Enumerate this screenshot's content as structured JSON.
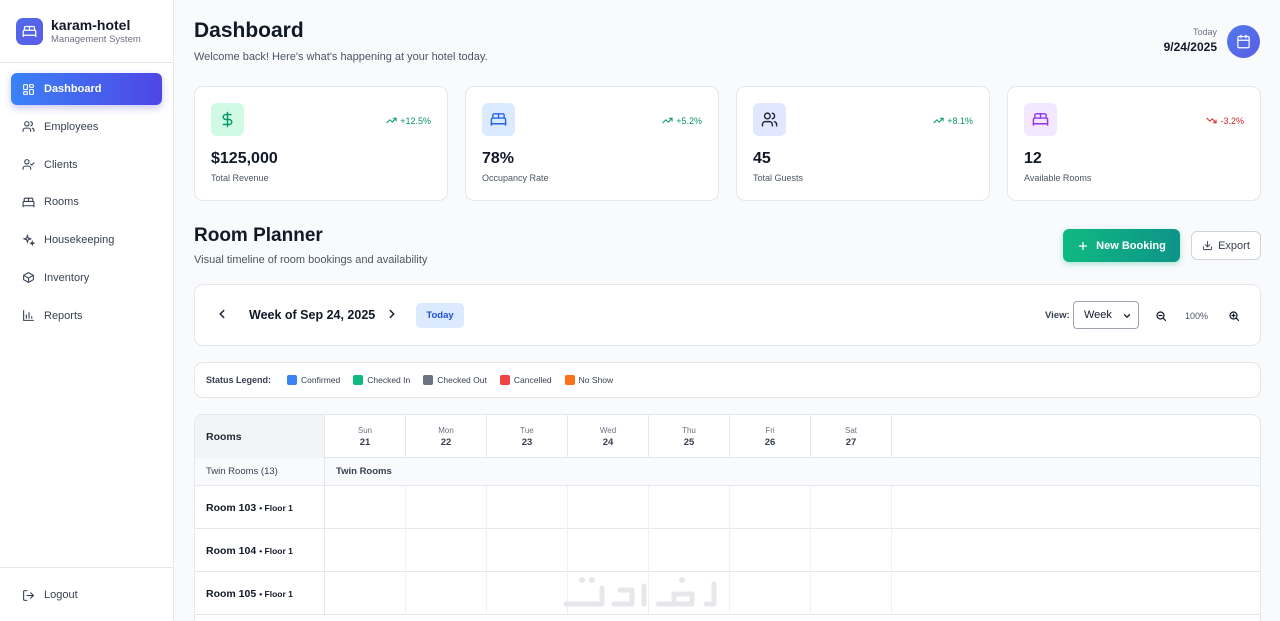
{
  "brand": {
    "name": "karam-hotel",
    "subtitle": "Management System"
  },
  "nav": [
    {
      "label": "Dashboard",
      "icon": "dashboard-icon",
      "active": true
    },
    {
      "label": "Employees",
      "icon": "users-icon"
    },
    {
      "label": "Clients",
      "icon": "user-check-icon"
    },
    {
      "label": "Rooms",
      "icon": "bed-icon"
    },
    {
      "label": "Housekeeping",
      "icon": "sparkles-icon"
    },
    {
      "label": "Inventory",
      "icon": "package-icon"
    },
    {
      "label": "Reports",
      "icon": "bar-chart-icon"
    }
  ],
  "logout_label": "Logout",
  "header": {
    "title": "Dashboard",
    "subtitle": "Welcome back! Here's what's happening at your hotel today.",
    "today_label": "Today",
    "today_date": "9/24/2025"
  },
  "stats": [
    {
      "value": "$125,000",
      "label": "Total Revenue",
      "trend": "+12.5%",
      "direction": "up",
      "icon": "dollar-icon",
      "icon_bg": "#d1fae5",
      "icon_color": "#059669"
    },
    {
      "value": "78%",
      "label": "Occupancy Rate",
      "trend": "+5.2%",
      "direction": "up",
      "icon": "bed-icon",
      "icon_bg": "#dbeafe",
      "icon_color": "#2563eb"
    },
    {
      "value": "45",
      "label": "Total Guests",
      "trend": "+8.1%",
      "direction": "up",
      "icon": "users-icon",
      "icon_bg": "#e0e7ff",
      "icon_color": "#1f2937"
    },
    {
      "value": "12",
      "label": "Available Rooms",
      "trend": "-3.2%",
      "direction": "down",
      "icon": "bed-icon",
      "icon_bg": "#f3e8ff",
      "icon_color": "#9333ea"
    }
  ],
  "planner": {
    "title": "Room Planner",
    "subtitle": "Visual timeline of room bookings and availability",
    "new_booking_label": "New Booking",
    "export_label": "Export",
    "week_label": "Week of Sep 24, 2025",
    "today_button": "Today",
    "view_label": "View:",
    "view_value": "Week",
    "zoom": "100%"
  },
  "legend": {
    "title": "Status Legend:",
    "items": [
      {
        "label": "Confirmed",
        "color": "#3b82f6"
      },
      {
        "label": "Checked In",
        "color": "#10b981"
      },
      {
        "label": "Checked Out",
        "color": "#6b7280"
      },
      {
        "label": "Cancelled",
        "color": "#ef4444"
      },
      {
        "label": "No Show",
        "color": "#f97316"
      }
    ]
  },
  "grid": {
    "rooms_header": "Rooms",
    "days": [
      {
        "name": "Sun",
        "num": "21"
      },
      {
        "name": "Mon",
        "num": "22"
      },
      {
        "name": "Tue",
        "num": "23"
      },
      {
        "name": "Wed",
        "num": "24"
      },
      {
        "name": "Thu",
        "num": "25"
      },
      {
        "name": "Fri",
        "num": "26"
      },
      {
        "name": "Sat",
        "num": "27"
      }
    ],
    "group_left": "Twin Rooms (13)",
    "group_right": "Twin Rooms",
    "rooms": [
      {
        "name": "Room 103",
        "floor": "• Floor 1"
      },
      {
        "name": "Room 104",
        "floor": "• Floor 1"
      },
      {
        "name": "Room 105",
        "floor": "• Floor 1"
      }
    ]
  },
  "colors": {
    "accent": "#4f46e5",
    "success": "#10b981",
    "danger": "#dc2626"
  }
}
